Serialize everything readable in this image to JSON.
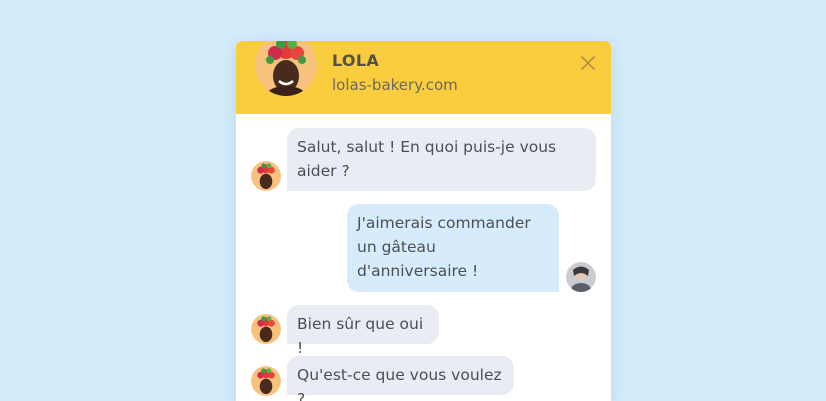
{
  "header": {
    "title": "LOLA",
    "subtitle": "lolas-bakery.com"
  },
  "icons": {
    "close": "close-icon",
    "bot_avatar": "lola-avatar",
    "user_avatar": "user-avatar"
  },
  "colors": {
    "background": "#d3ebfb",
    "header": "#f9cd3e",
    "bot_bubble": "#e9ecf2",
    "user_bubble": "#d6ecfc"
  },
  "messages": [
    {
      "from": "bot",
      "text": "Salut, salut ! En quoi puis-je vous aider ?"
    },
    {
      "from": "user",
      "text": "J'aimerais commander un gâteau d'anniversaire !"
    },
    {
      "from": "bot",
      "text": "Bien sûr que oui !"
    },
    {
      "from": "bot",
      "text": "Qu'est-ce que vous voulez ?"
    }
  ]
}
